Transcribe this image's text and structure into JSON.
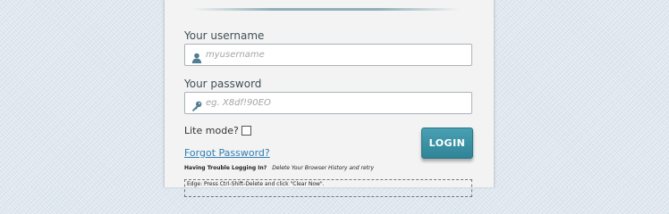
{
  "form": {
    "username_label": "Your username",
    "username_placeholder": "myusername",
    "username_value": "",
    "password_label": "Your password",
    "password_placeholder": "eg. X8df!90EO",
    "password_value": "",
    "lite_mode_label": "Lite mode?",
    "lite_mode_checked": false,
    "forgot_link": "Forgot Password?",
    "login_button": "LOGIN"
  },
  "help": {
    "trouble_title": "Having Trouble Logging In?",
    "trouble_hint": "Delete Your Browser History and retry",
    "edge_note": "Edge: Press Ctrl-Shift-Delete and click \"Clear Now\"."
  },
  "icons": {
    "username_icon": "user-icon",
    "password_icon": "key-icon"
  },
  "colors": {
    "accent": "#3a93a6",
    "link": "#2f7fb4"
  }
}
